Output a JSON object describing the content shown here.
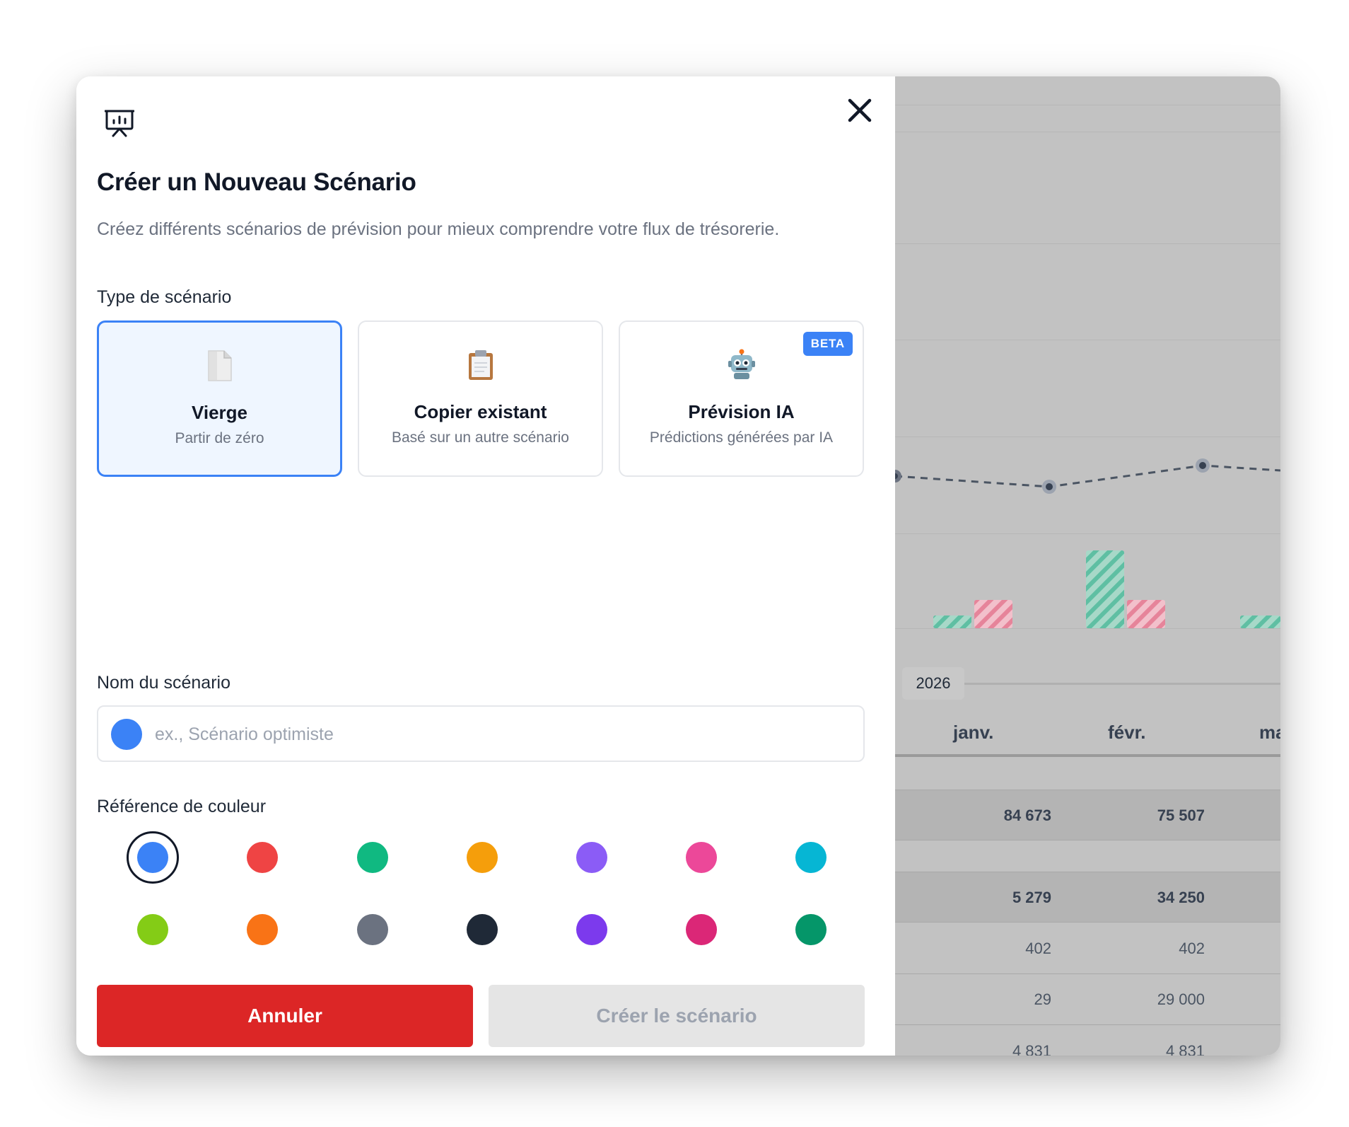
{
  "modal": {
    "title": "Créer un Nouveau Scénario",
    "subtitle": "Créez différents scénarios de prévision pour mieux comprendre votre flux de trésorerie.",
    "type_label": "Type de scénario",
    "types": [
      {
        "title": "Vierge",
        "desc": "Partir de zéro",
        "icon": "page-icon",
        "selected": true
      },
      {
        "title": "Copier existant",
        "desc": "Basé sur un autre scénario",
        "icon": "clipboard-icon",
        "selected": false
      },
      {
        "title": "Prévision IA",
        "desc": "Prédictions générées par IA",
        "icon": "robot-icon",
        "selected": false,
        "badge": "BETA"
      }
    ],
    "name_label": "Nom du scénario",
    "name_placeholder": "ex., Scénario optimiste",
    "name_value": "",
    "color_label": "Référence de couleur",
    "colors": [
      "#3b82f6",
      "#ef4444",
      "#10b981",
      "#f59e0b",
      "#8b5cf6",
      "#ec4899",
      "#06b6d4",
      "#84cc16",
      "#f97316",
      "#6b7280",
      "#1f2937",
      "#7c3aed",
      "#db2777",
      "#059669"
    ],
    "selected_color": "#3b82f6",
    "cancel_label": "Annuler",
    "create_label": "Créer le scénario"
  },
  "background": {
    "year": "2026",
    "months": [
      "janv.",
      "févr.",
      "ma"
    ],
    "rows": [
      {
        "values": [
          "84 673",
          "75 507"
        ],
        "style": "band-bold"
      },
      {
        "values": [
          "5 279",
          "34 250"
        ],
        "style": "band-bold"
      },
      {
        "values": [
          "402",
          "402"
        ],
        "style": "plain"
      },
      {
        "values": [
          "29",
          "29 000"
        ],
        "style": "plain"
      },
      {
        "values": [
          "4 831",
          "4 831"
        ],
        "style": "plain"
      }
    ],
    "colors": {
      "income": "#5fbfa3",
      "expense": "#e6849a"
    }
  }
}
